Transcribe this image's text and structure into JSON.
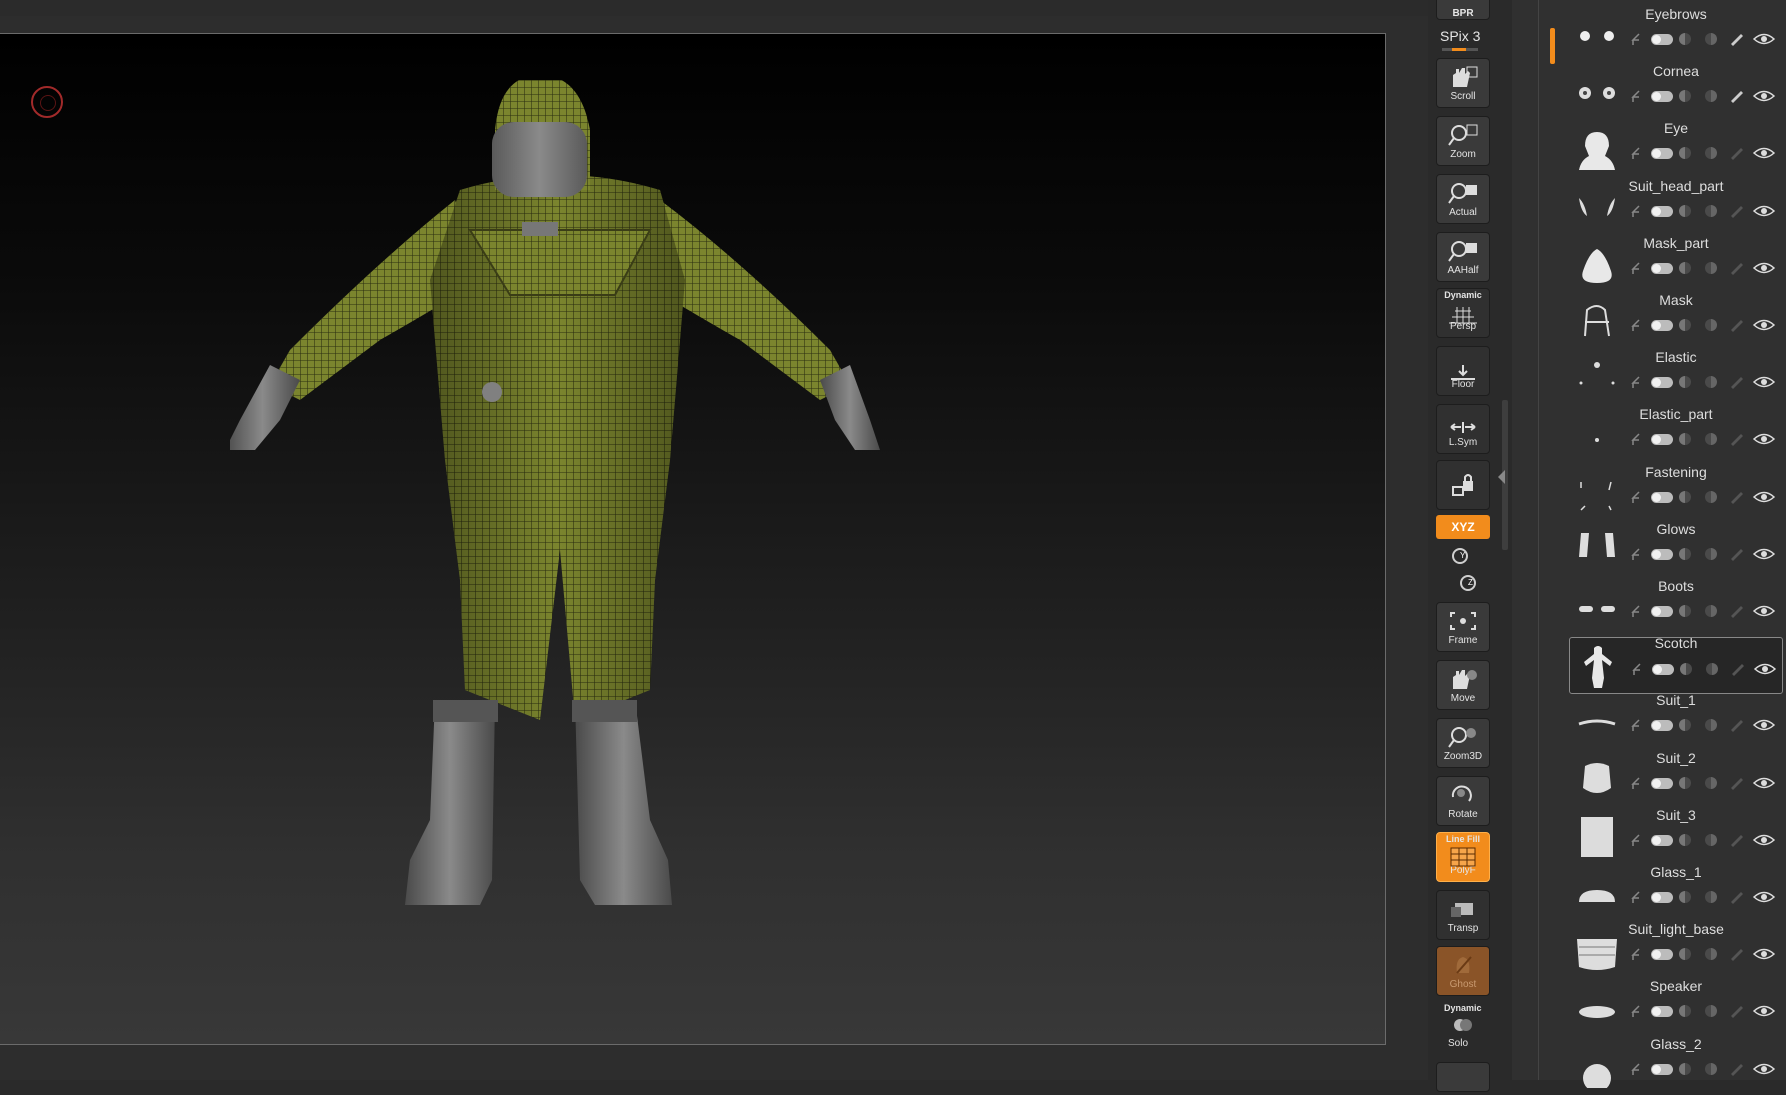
{
  "shelf": {
    "bpr": "BPR",
    "spix": "SPix 3",
    "buttons": [
      {
        "label": "Scroll",
        "icon": "hand-scroll-icon"
      },
      {
        "label": "Zoom",
        "icon": "zoom-icon"
      },
      {
        "label": "Actual",
        "icon": "actual-icon"
      },
      {
        "label": "AAHalf",
        "icon": "aahalf-icon"
      },
      {
        "label": "Persp",
        "top_label": "Dynamic",
        "icon": "perspective-grid-icon"
      },
      {
        "label": "Floor",
        "icon": "floor-icon"
      },
      {
        "label": "L.Sym",
        "icon": "local-symmetry-icon"
      },
      {
        "label": "",
        "icon": "lock-camera-icon"
      }
    ],
    "xyz": "XYZ",
    "rot_y": "Y",
    "rot_z": "Z",
    "buttons2": [
      {
        "label": "Frame",
        "icon": "frame-icon"
      },
      {
        "label": "Move",
        "icon": "move-hand-icon"
      },
      {
        "label": "Zoom3D",
        "icon": "zoom3d-icon"
      },
      {
        "label": "Rotate",
        "icon": "rotate-icon"
      },
      {
        "label": "PolyF",
        "top_label": "Line Fill",
        "icon": "polyframe-icon",
        "active": true
      },
      {
        "label": "Transp",
        "icon": "transparency-icon"
      },
      {
        "label": "Ghost",
        "icon": "ghost-icon",
        "ghost": true
      }
    ],
    "solo_top": "Dynamic",
    "solo": "Solo"
  },
  "subtool": {
    "items": [
      {
        "name": "Eyebrows",
        "thumb": "dots"
      },
      {
        "name": "Cornea",
        "thumb": "dots2"
      },
      {
        "name": "Eye",
        "thumb": "head"
      },
      {
        "name": "Suit_head_part",
        "thumb": "wings"
      },
      {
        "name": "Mask_part",
        "thumb": "blob"
      },
      {
        "name": "Mask",
        "thumb": "strap"
      },
      {
        "name": "Elastic",
        "thumb": "small"
      },
      {
        "name": "Elastic_part",
        "thumb": "tiny"
      },
      {
        "name": "Fastening",
        "thumb": "ticks"
      },
      {
        "name": "Glows",
        "thumb": "gloves"
      },
      {
        "name": "Boots",
        "thumb": "boots"
      },
      {
        "name": "Scotch",
        "thumb": "suit",
        "selected": true
      },
      {
        "name": "Suit_1",
        "thumb": "band"
      },
      {
        "name": "Suit_2",
        "thumb": "hood"
      },
      {
        "name": "Suit_3",
        "thumb": "glass"
      },
      {
        "name": "Glass_1",
        "thumb": "light"
      },
      {
        "name": "Suit_light_base",
        "thumb": "grill"
      },
      {
        "name": "Speaker",
        "thumb": "pill"
      },
      {
        "name": "Glass_2",
        "thumb": "ball"
      }
    ]
  },
  "colors": {
    "accent": "#f28c1c",
    "suit": "#6f7a2a",
    "rubber": "#6c6c6c"
  }
}
